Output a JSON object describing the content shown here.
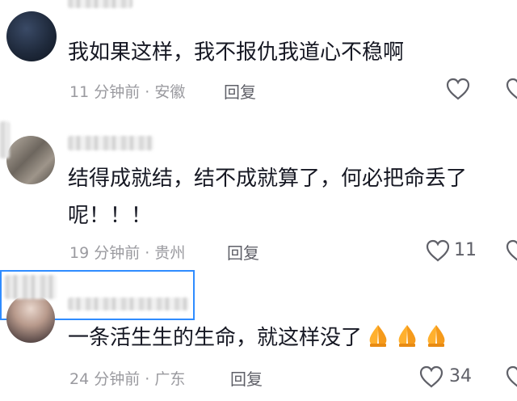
{
  "comments": [
    {
      "text": "我如果这样，我不报仇我道心不稳啊",
      "time": "11 分钟前",
      "location": "安徽",
      "reply": "回复",
      "likes": ""
    },
    {
      "text_line1": "结得成就结，结不成就算了，何必把命丢了",
      "text_line2": "呢！！！",
      "time": "19 分钟前",
      "location": "贵州",
      "reply": "回复",
      "likes": "11"
    },
    {
      "text": "一条活生生的生命，就这样没了",
      "emojis": [
        "folded-hands",
        "folded-hands",
        "folded-hands"
      ],
      "time": "24 分钟前",
      "location": "广东",
      "reply": "回复",
      "likes": "34"
    }
  ],
  "separator": "·",
  "colors": {
    "text": "#161823",
    "meta": "#9a9a9f",
    "highlight": "#2f8cff"
  }
}
